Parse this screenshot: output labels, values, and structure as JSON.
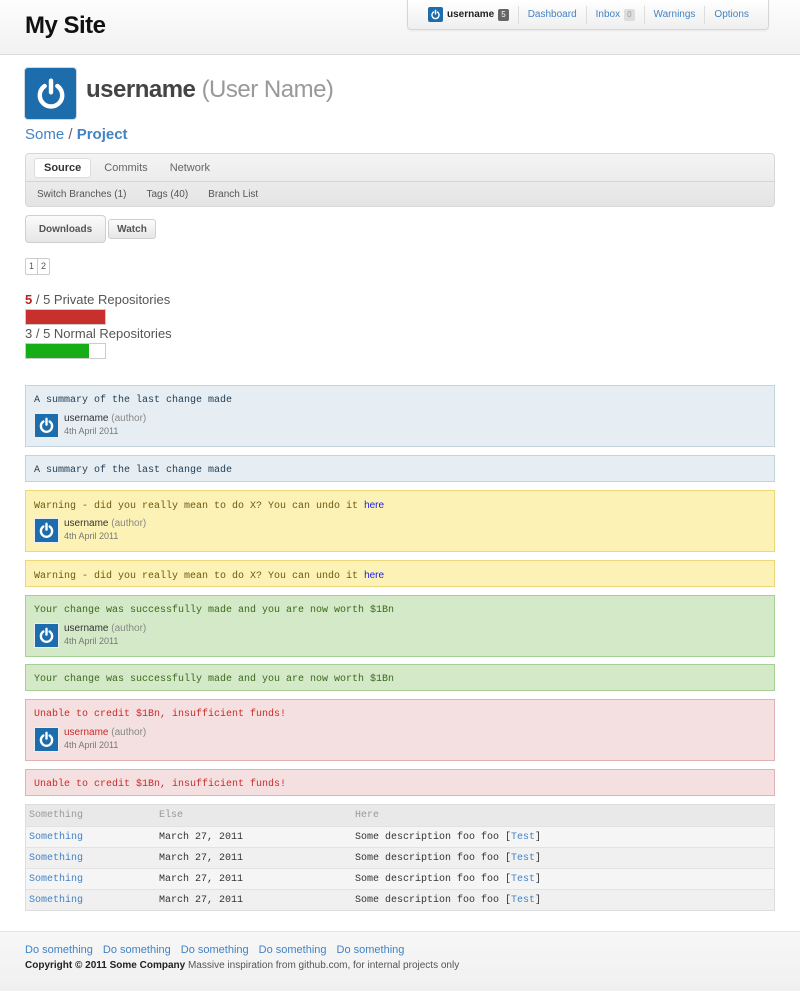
{
  "header": {
    "site_title": "My Site",
    "userbar": {
      "username": "username",
      "user_count": "5",
      "links": [
        {
          "label": "Dashboard"
        },
        {
          "label": "Inbox",
          "count": "0"
        },
        {
          "label": "Warnings"
        },
        {
          "label": "Options"
        }
      ]
    }
  },
  "profile": {
    "username": "username",
    "full_name": "(User Name)",
    "avatar_icon": "power-icon"
  },
  "breadcrumb": {
    "owner": "Some",
    "separator": "/",
    "repo": "Project"
  },
  "tabs": [
    "Source",
    "Commits",
    "Network"
  ],
  "subtabs": [
    "Switch Branches (1)",
    "Tags (40)",
    "Branch List"
  ],
  "buttons": {
    "downloads": "Downloads",
    "watch": "Watch"
  },
  "pagination": [
    "1",
    "2"
  ],
  "quotas": [
    {
      "used": "5",
      "rest": " / 5 Private Repositories",
      "fraction": 1.0,
      "color": "#c8302e"
    },
    {
      "used": "3",
      "rest": " / 5 Normal Repositories",
      "fraction": 0.8,
      "color": "#16ad16"
    }
  ],
  "messages": [
    {
      "text": "A summary of the last change made",
      "author": "username",
      "role": "(author)",
      "date": "4th April 2011"
    },
    {
      "text": "A summary of the last change made"
    },
    {
      "text": "Warning - did you really mean to do X? You can undo it ",
      "link": "here",
      "author": "username",
      "role": "(author)",
      "date": "4th April 2011"
    },
    {
      "text": "Warning - did you really mean to do X? You can undo it ",
      "link": "here"
    },
    {
      "text": "Your change was successfully made and you are now worth $1Bn",
      "author": "username",
      "role": "(author)",
      "date": "4th April 2011"
    },
    {
      "text": "Your change was successfully made and you are now worth $1Bn"
    },
    {
      "text": "Unable to credit $1Bn, insufficient funds!",
      "author": "username",
      "role": "(author)",
      "date": "4th April 2011"
    },
    {
      "text": "Unable to credit $1Bn, insufficient funds!"
    }
  ],
  "table": {
    "headers": [
      "Something",
      "Else",
      "Here"
    ],
    "rows": [
      {
        "name": "Something",
        "date": "March 27, 2011",
        "desc": "Some description foo foo [",
        "link": "Test",
        "close": "]"
      },
      {
        "name": "Something",
        "date": "March 27, 2011",
        "desc": "Some description foo foo [",
        "link": "Test",
        "close": "]"
      },
      {
        "name": "Something",
        "date": "March 27, 2011",
        "desc": "Some description foo foo [",
        "link": "Test",
        "close": "]"
      },
      {
        "name": "Something",
        "date": "March 27, 2011",
        "desc": "Some description foo foo [",
        "link": "Test",
        "close": "]"
      }
    ]
  },
  "footer": {
    "links": [
      "Do something",
      "Do something",
      "Do something",
      "Do something",
      "Do something"
    ],
    "copyright_bold": "Copyright © 2011 Some Company",
    "copyright_rest": " Massive inspiration from github.com, for internal projects only"
  }
}
